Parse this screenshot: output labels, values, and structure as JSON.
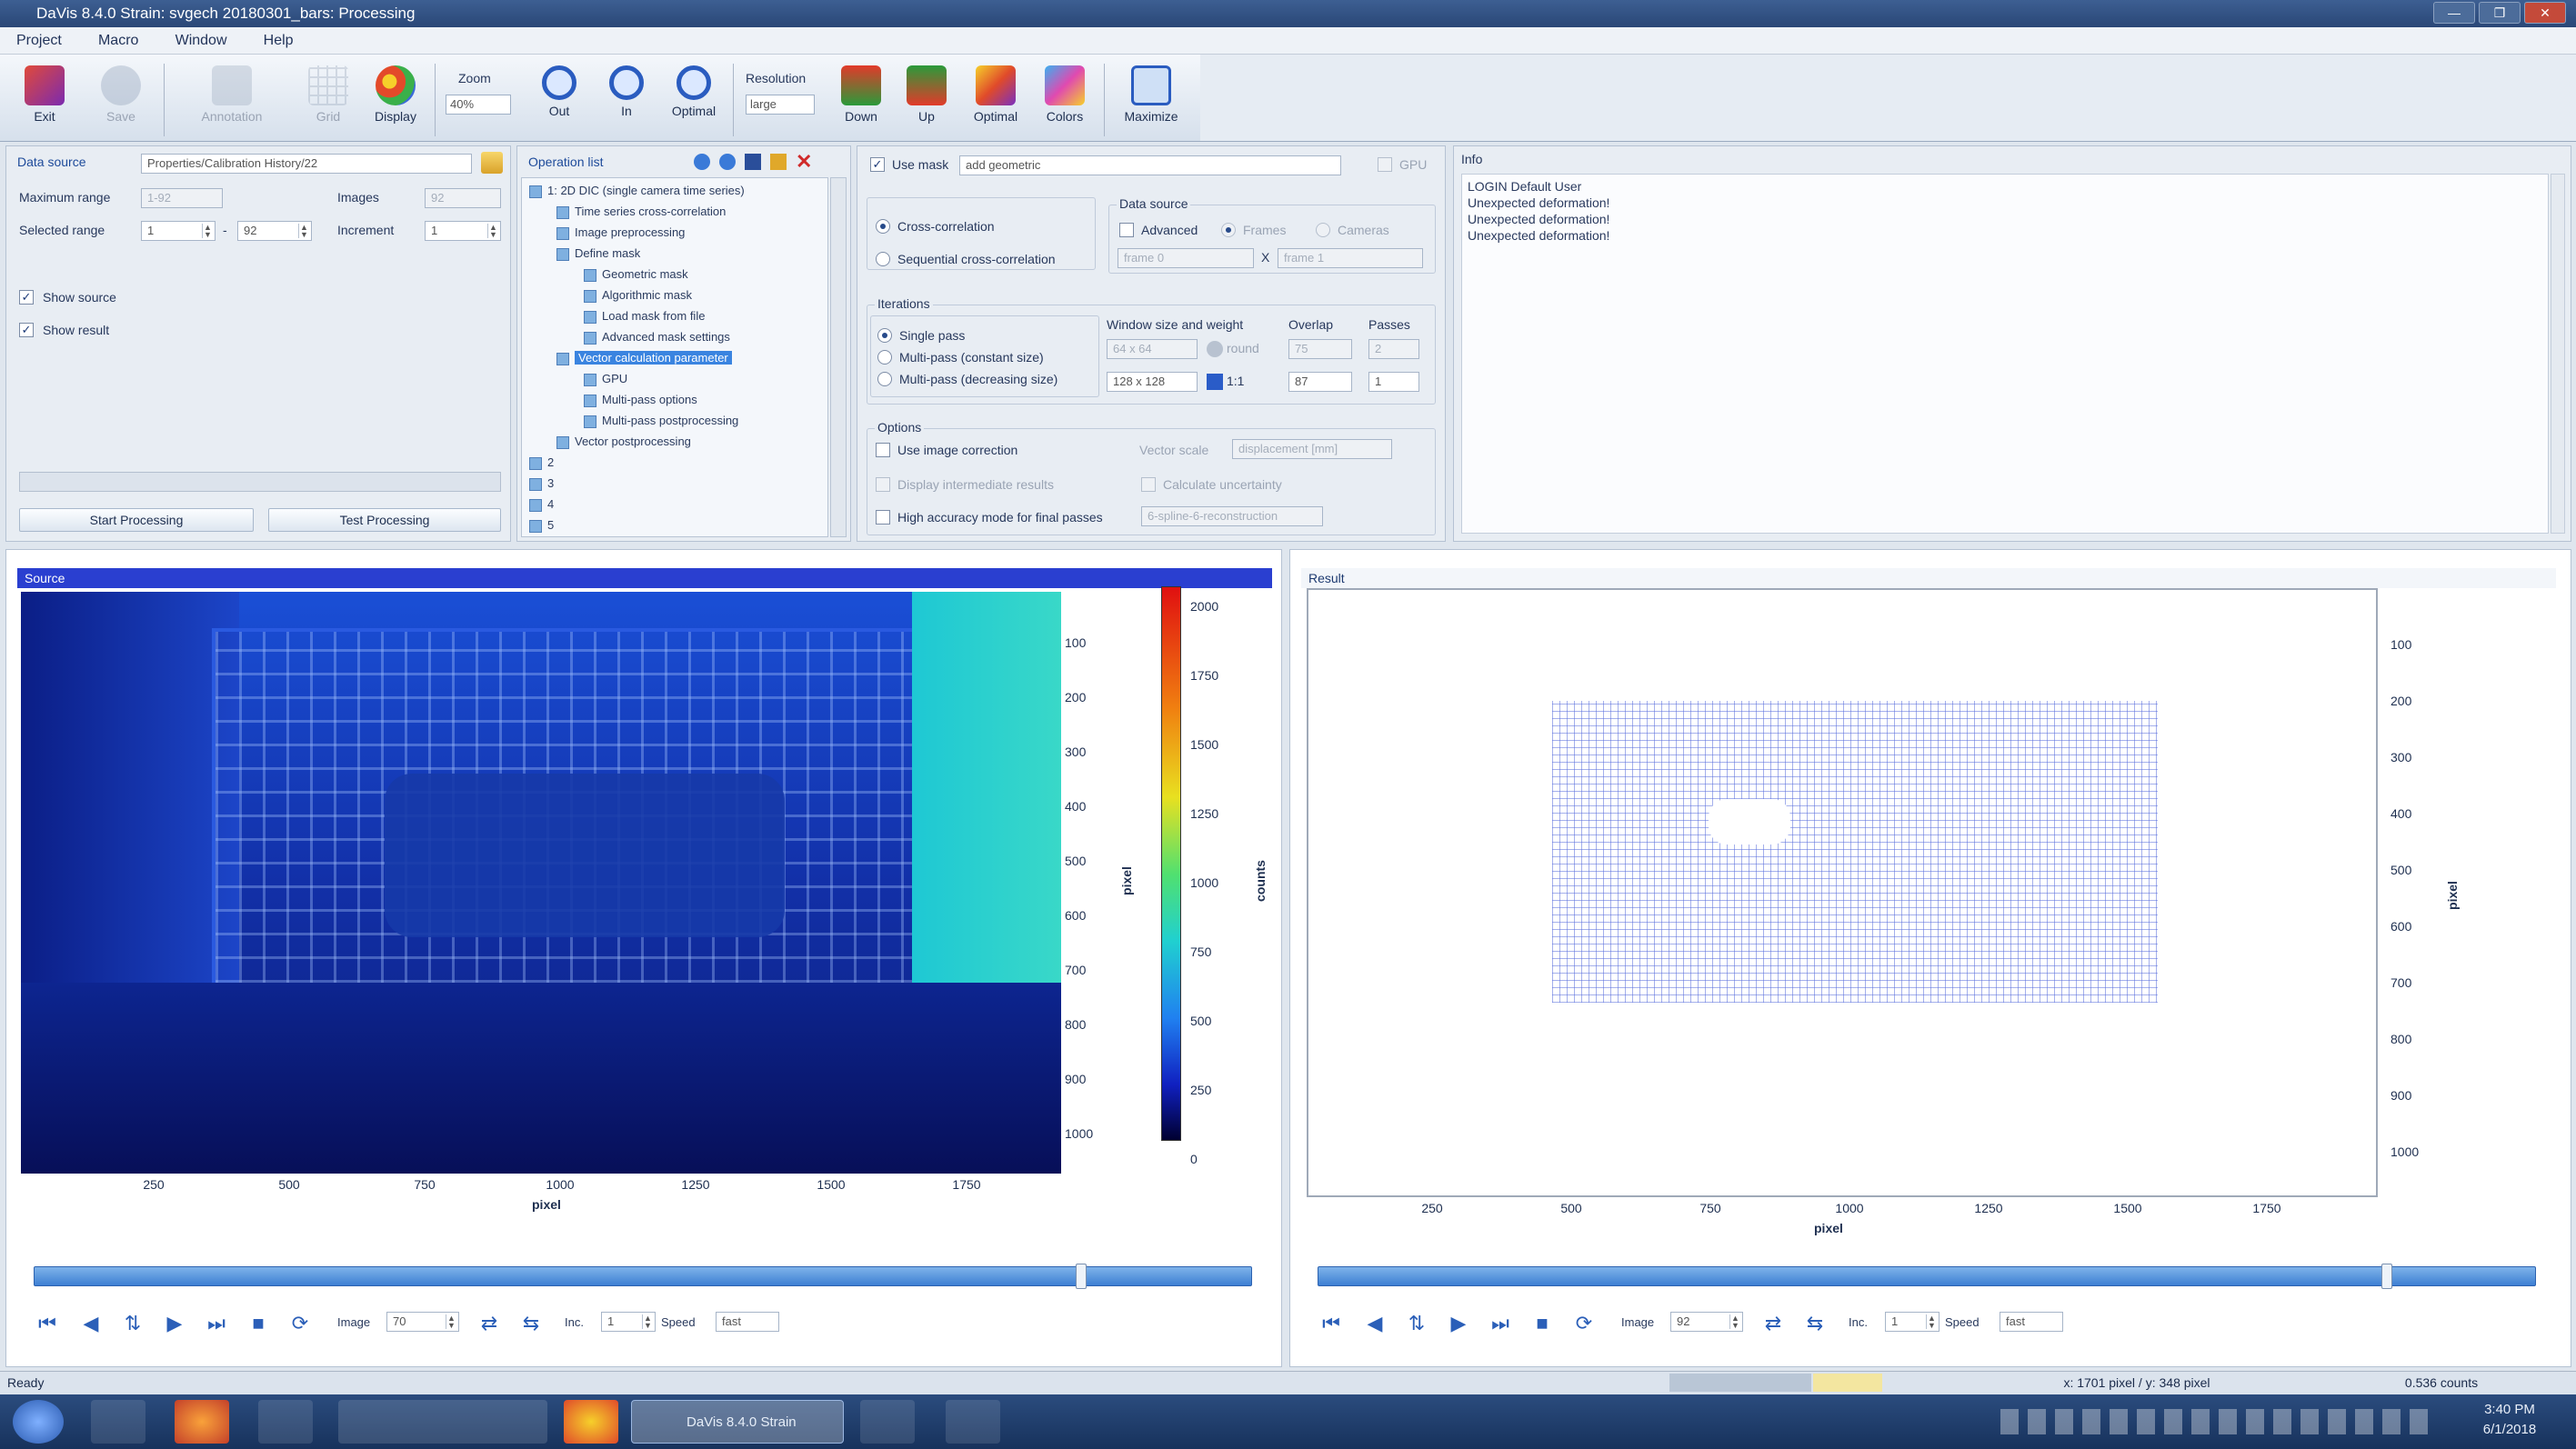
{
  "window": {
    "title": "DaVis 8.4.0 Strain: svgech 20180301_bars: Processing"
  },
  "menu": [
    "Project",
    "Macro",
    "Window",
    "Help"
  ],
  "toolbar": {
    "exit": "Exit",
    "save": "Save",
    "annotation": "Annotation",
    "grid": "Grid",
    "display": "Display",
    "zoom_label": "Zoom",
    "zoom_value": "40%",
    "zoom_out": "Out",
    "zoom_in": "In",
    "zoom_optimal": "Optimal",
    "resolution_label": "Resolution",
    "resolution_value": "large",
    "down": "Down",
    "up": "Up",
    "optimal": "Optimal",
    "colors": "Colors",
    "maximize": "Maximize"
  },
  "datasource": {
    "title": "Data source",
    "path": "Properties/Calibration History/22",
    "max_range_label": "Maximum range",
    "max_range_value": "1-92",
    "images_label": "Images",
    "images_value": "92",
    "selected_range_label": "Selected range",
    "selected_from": "1",
    "selected_dash": "-",
    "selected_to": "92",
    "increment_label": "Increment",
    "increment_value": "1",
    "show_source": "Show source",
    "show_result": "Show result",
    "start_processing": "Start Processing",
    "test_processing": "Test Processing"
  },
  "oplist": {
    "title": "Operation list",
    "items": [
      {
        "label": "1: 2D DIC (single camera time series)",
        "level": 0
      },
      {
        "label": "Time series cross-correlation",
        "level": 1
      },
      {
        "label": "Image preprocessing",
        "level": 1
      },
      {
        "label": "Define mask",
        "level": 1
      },
      {
        "label": "Geometric mask",
        "level": 2
      },
      {
        "label": "Algorithmic mask",
        "level": 2
      },
      {
        "label": "Load mask from file",
        "level": 2
      },
      {
        "label": "Advanced mask settings",
        "level": 2
      },
      {
        "label": "Vector calculation parameter",
        "level": 1,
        "selected": true
      },
      {
        "label": "GPU",
        "level": 2
      },
      {
        "label": "Multi-pass options",
        "level": 2
      },
      {
        "label": "Multi-pass postprocessing",
        "level": 2
      },
      {
        "label": "Vector postprocessing",
        "level": 1
      },
      {
        "label": "2",
        "level": 0
      },
      {
        "label": "3",
        "level": 0
      },
      {
        "label": "4",
        "level": 0
      },
      {
        "label": "5",
        "level": 0
      }
    ]
  },
  "settings": {
    "use_mask": "Use mask",
    "mask_mode": "add geometric",
    "gpu": "GPU",
    "cross_correlation": "Cross-correlation",
    "sequential_cross_correlation": "Sequential cross-correlation",
    "data_source_title": "Data source",
    "advanced": "Advanced",
    "frames": "Frames",
    "cameras": "Cameras",
    "frame_a": "frame 0",
    "frame_x": "X",
    "frame_b": "frame 1",
    "iterations_title": "Iterations",
    "single_pass": "Single pass",
    "multi_pass_constant": "Multi-pass (constant size)",
    "multi_pass_decreasing": "Multi-pass (decreasing size)",
    "window_size_weight": "Window size and weight",
    "overlap_title": "Overlap",
    "passes_title": "Passes",
    "ws1": "64 x 64",
    "weight1": "round",
    "overlap1": "75",
    "passes1": "2",
    "ws2": "128 x 128",
    "weight2": "1:1",
    "overlap2": "87",
    "passes2": "1",
    "options_title": "Options",
    "use_image_correction": "Use image correction",
    "vector_scale_label": "Vector scale",
    "vector_scale_value": "displacement [mm]",
    "display_intermediate": "Display intermediate results",
    "calculate_uncertainty": "Calculate uncertainty",
    "high_accuracy": "High accuracy mode for final passes",
    "reconstruction": "6-spline-6-reconstruction"
  },
  "info": {
    "title": "Info",
    "lines": [
      "LOGIN Default User",
      "Unexpected deformation!",
      "Unexpected deformation!",
      "Unexpected deformation!"
    ]
  },
  "source": {
    "title": "Source",
    "x_ticks": [
      "250",
      "500",
      "750",
      "1000",
      "1250",
      "1500",
      "1750"
    ],
    "xlabel": "pixel",
    "y_ticks": [
      "100",
      "200",
      "300",
      "400",
      "500",
      "600",
      "700",
      "800",
      "900",
      "1000"
    ],
    "ylabel": "pixel",
    "cbar_ticks": [
      "2000",
      "1750",
      "1500",
      "1250",
      "1000",
      "750",
      "500",
      "250",
      "0"
    ],
    "cbar_label": "counts",
    "image_label": "Image",
    "image_value": "70",
    "inc_label": "Inc.",
    "inc_value": "1",
    "speed_label": "Speed",
    "speed_value": "fast"
  },
  "result": {
    "title": "Result",
    "x_ticks": [
      "250",
      "500",
      "750",
      "1000",
      "1250",
      "1500",
      "1750"
    ],
    "xlabel": "pixel",
    "y_ticks": [
      "100",
      "200",
      "300",
      "400",
      "500",
      "600",
      "700",
      "800",
      "900",
      "1000"
    ],
    "ylabel": "pixel",
    "image_label": "Image",
    "image_value": "92",
    "inc_label": "Inc.",
    "inc_value": "1",
    "speed_label": "Speed",
    "speed_value": "fast"
  },
  "status": {
    "left": "Ready",
    "coords": "x: 1701 pixel / y: 348 pixel",
    "counts": "0.536 counts"
  },
  "taskbar": {
    "time": "3:40 PM",
    "date": "6/1/2018",
    "task_label": "DaVis 8.4.0 Strain"
  }
}
